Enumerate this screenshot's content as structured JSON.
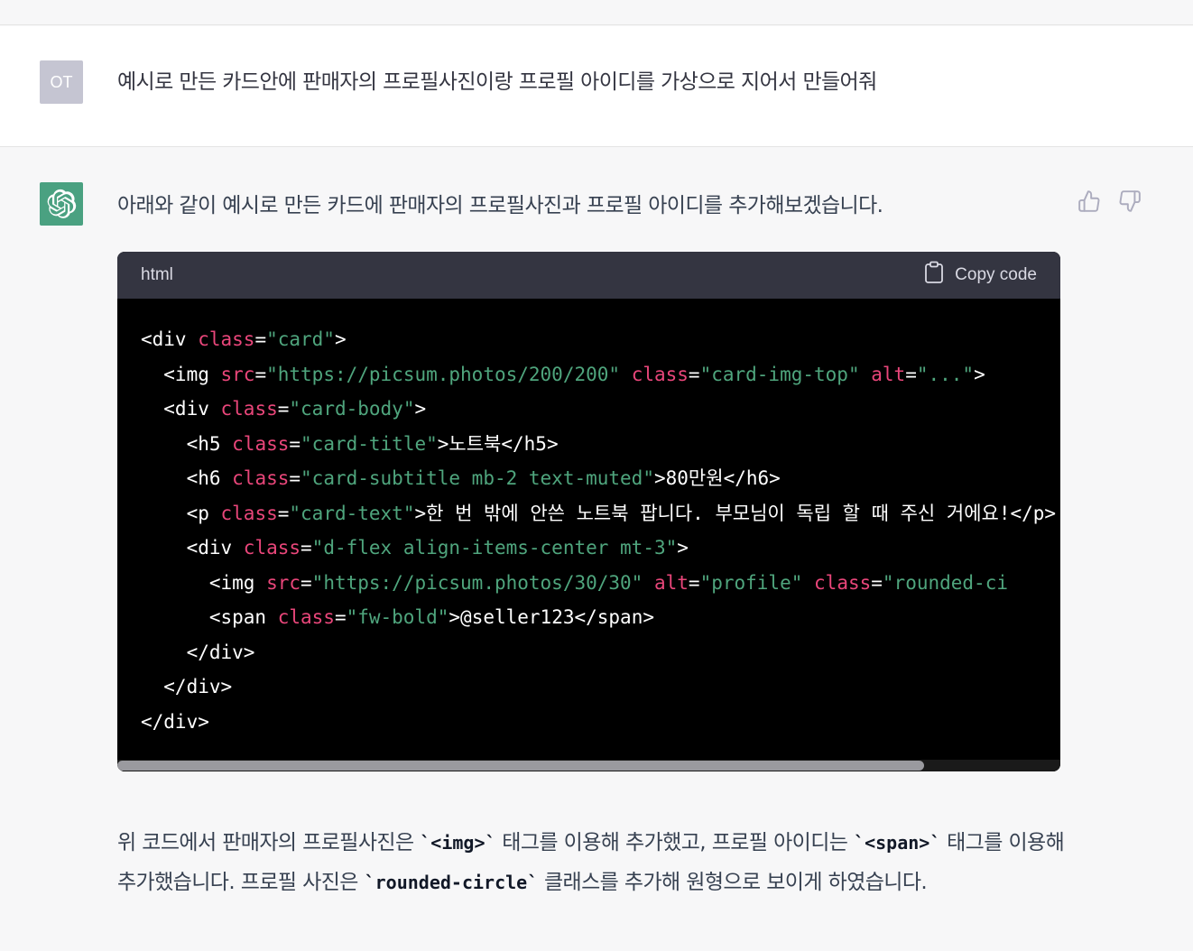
{
  "user_message": {
    "avatar_initials": "OT",
    "text": "예시로 만든 카드안에 판매자의 프로필사진이랑 프로필 아이디를 가상으로 지어서 만들어줘"
  },
  "assistant_message": {
    "intro": "아래와 같이 예시로 만든 카드에 판매자의 프로필사진과 프로필 아이디를 추가해보겠습니다.",
    "code_block": {
      "language": "html",
      "copy_label": "Copy code",
      "scroll_position_fraction": 0.86,
      "lines": [
        [
          {
            "t": "tag",
            "v": "<div "
          },
          {
            "t": "attr",
            "v": "class"
          },
          {
            "t": "tag",
            "v": "="
          },
          {
            "t": "str",
            "v": "\"card\""
          },
          {
            "t": "tag",
            "v": ">"
          }
        ],
        [
          {
            "t": "tag",
            "v": "  <img "
          },
          {
            "t": "attr",
            "v": "src"
          },
          {
            "t": "tag",
            "v": "="
          },
          {
            "t": "str",
            "v": "\"https://picsum.photos/200/200\""
          },
          {
            "t": "tag",
            "v": " "
          },
          {
            "t": "attr",
            "v": "class"
          },
          {
            "t": "tag",
            "v": "="
          },
          {
            "t": "str",
            "v": "\"card-img-top\""
          },
          {
            "t": "tag",
            "v": " "
          },
          {
            "t": "attr",
            "v": "alt"
          },
          {
            "t": "tag",
            "v": "="
          },
          {
            "t": "str",
            "v": "\"...\""
          },
          {
            "t": "tag",
            "v": ">"
          }
        ],
        [
          {
            "t": "tag",
            "v": "  <div "
          },
          {
            "t": "attr",
            "v": "class"
          },
          {
            "t": "tag",
            "v": "="
          },
          {
            "t": "str",
            "v": "\"card-body\""
          },
          {
            "t": "tag",
            "v": ">"
          }
        ],
        [
          {
            "t": "tag",
            "v": "    <h5 "
          },
          {
            "t": "attr",
            "v": "class"
          },
          {
            "t": "tag",
            "v": "="
          },
          {
            "t": "str",
            "v": "\"card-title\""
          },
          {
            "t": "tag",
            "v": ">"
          },
          {
            "t": "text",
            "v": "노트북"
          },
          {
            "t": "tag",
            "v": "</h5>"
          }
        ],
        [
          {
            "t": "tag",
            "v": "    <h6 "
          },
          {
            "t": "attr",
            "v": "class"
          },
          {
            "t": "tag",
            "v": "="
          },
          {
            "t": "str",
            "v": "\"card-subtitle mb-2 text-muted\""
          },
          {
            "t": "tag",
            "v": ">"
          },
          {
            "t": "text",
            "v": "80만원"
          },
          {
            "t": "tag",
            "v": "</h6>"
          }
        ],
        [
          {
            "t": "tag",
            "v": "    <p "
          },
          {
            "t": "attr",
            "v": "class"
          },
          {
            "t": "tag",
            "v": "="
          },
          {
            "t": "str",
            "v": "\"card-text\""
          },
          {
            "t": "tag",
            "v": ">"
          },
          {
            "t": "text",
            "v": "한 번 밖에 안쓴 노트북 팝니다. 부모님이 독립 할 때 주신 거에요!"
          },
          {
            "t": "tag",
            "v": "</p>"
          }
        ],
        [
          {
            "t": "tag",
            "v": "    <div "
          },
          {
            "t": "attr",
            "v": "class"
          },
          {
            "t": "tag",
            "v": "="
          },
          {
            "t": "str",
            "v": "\"d-flex align-items-center mt-3\""
          },
          {
            "t": "tag",
            "v": ">"
          }
        ],
        [
          {
            "t": "tag",
            "v": "      <img "
          },
          {
            "t": "attr",
            "v": "src"
          },
          {
            "t": "tag",
            "v": "="
          },
          {
            "t": "str",
            "v": "\"https://picsum.photos/30/30\""
          },
          {
            "t": "tag",
            "v": " "
          },
          {
            "t": "attr",
            "v": "alt"
          },
          {
            "t": "tag",
            "v": "="
          },
          {
            "t": "str",
            "v": "\"profile\""
          },
          {
            "t": "tag",
            "v": " "
          },
          {
            "t": "attr",
            "v": "class"
          },
          {
            "t": "tag",
            "v": "="
          },
          {
            "t": "str",
            "v": "\"rounded-ci"
          }
        ],
        [
          {
            "t": "tag",
            "v": "      <span "
          },
          {
            "t": "attr",
            "v": "class"
          },
          {
            "t": "tag",
            "v": "="
          },
          {
            "t": "str",
            "v": "\"fw-bold\""
          },
          {
            "t": "tag",
            "v": ">"
          },
          {
            "t": "text",
            "v": "@seller123"
          },
          {
            "t": "tag",
            "v": "</span>"
          }
        ],
        [
          {
            "t": "tag",
            "v": "    </div>"
          }
        ],
        [
          {
            "t": "tag",
            "v": "  </div>"
          }
        ],
        [
          {
            "t": "tag",
            "v": "</div>"
          }
        ]
      ]
    },
    "explanation": [
      {
        "t": "text",
        "v": "위 코드에서 판매자의 프로필사진은 "
      },
      {
        "t": "code",
        "v": "`<img>`"
      },
      {
        "t": "text",
        "v": " 태그를 이용해 추가했고, 프로필 아이디는 "
      },
      {
        "t": "code",
        "v": "`<span>`"
      },
      {
        "t": "text",
        "v": " 태그를 이용해 추가했습니다. 프로필 사진은 "
      },
      {
        "t": "code",
        "v": "`rounded-circle`"
      },
      {
        "t": "text",
        "v": " 클래스를 추가해 원형으로 보이게 하였습니다."
      }
    ]
  },
  "icons": {
    "avatar_assistant": "openai-logo-icon",
    "thumbs_up": "thumbs-up-icon",
    "thumbs_down": "thumbs-down-icon",
    "copy": "clipboard-icon"
  },
  "colors": {
    "assistant_avatar_bg": "#4aa181",
    "code_attr": "#e9467a",
    "code_string": "#4fa57d",
    "code_bg": "#000000",
    "code_header_bg": "#343541"
  }
}
